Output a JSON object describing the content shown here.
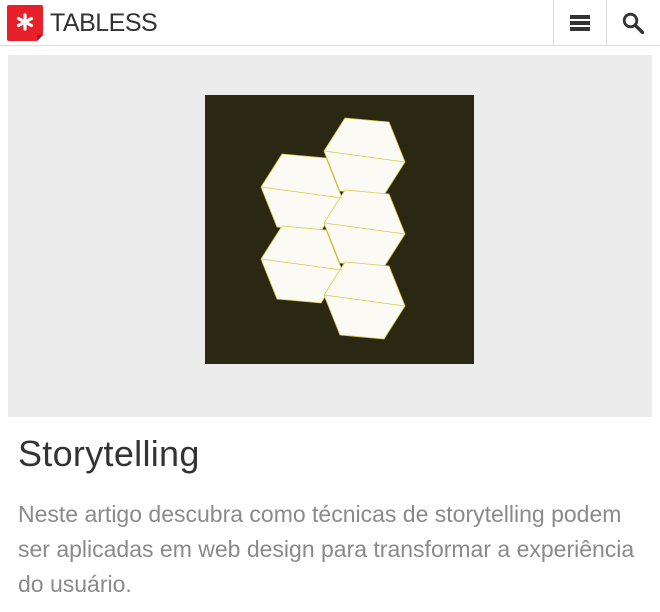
{
  "header": {
    "logo_text": "TABLESS",
    "brand_color": "#e8202a",
    "menu_icon": "menu-icon",
    "search_icon": "search-icon"
  },
  "article": {
    "title": "Storytelling",
    "excerpt": "Neste artigo descubra como técnicas de storytelling podem ser aplicadas em web design para transformar a experiência do usuário."
  }
}
